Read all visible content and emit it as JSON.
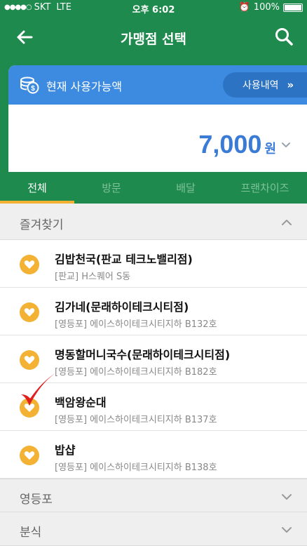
{
  "status_bar": {
    "carrier": "SKT",
    "network": "LTE",
    "time": "오후 6:02",
    "battery": "100%"
  },
  "nav": {
    "title": "가맹점 선택",
    "back_icon": "arrow-left-icon",
    "search_icon": "search-icon"
  },
  "balance": {
    "label": "현재 사용가능액",
    "history_label": "사용내역",
    "history_arrow": "»",
    "amount": "7,000",
    "unit": "원"
  },
  "tabs": [
    {
      "label": "전체",
      "active": true
    },
    {
      "label": "방문",
      "active": false
    },
    {
      "label": "배달",
      "active": false
    },
    {
      "label": "프랜차이즈",
      "active": false
    }
  ],
  "favorites": {
    "title": "즐겨찾기",
    "items": [
      {
        "name": "김밥천국(판교 테크노밸리점)",
        "address": "[판교] H스퀘어 S동"
      },
      {
        "name": "김가네(문래하이테크시티점)",
        "address": "[영등포] 에이스하이테크시티지하 B132호"
      },
      {
        "name": "명동할머니국수(문래하이테크시티점)",
        "address": "[영등포] 에이스하이테크시티지하 B182호"
      },
      {
        "name": "백암왕순대",
        "address": "[영등포] 에이스하이테크시티지하 B137호"
      },
      {
        "name": "밥샵",
        "address": "[영등포] 에이스하이테크시티지하 B138호"
      }
    ]
  },
  "sections": [
    {
      "title": "영등포"
    },
    {
      "title": "분식"
    }
  ],
  "colors": {
    "primary_green": "#1f8a4d",
    "card_blue": "#3d8be0",
    "accent_yellow": "#f3b234",
    "amount_blue": "#3a7bd5",
    "check_red": "#e01f1f"
  }
}
